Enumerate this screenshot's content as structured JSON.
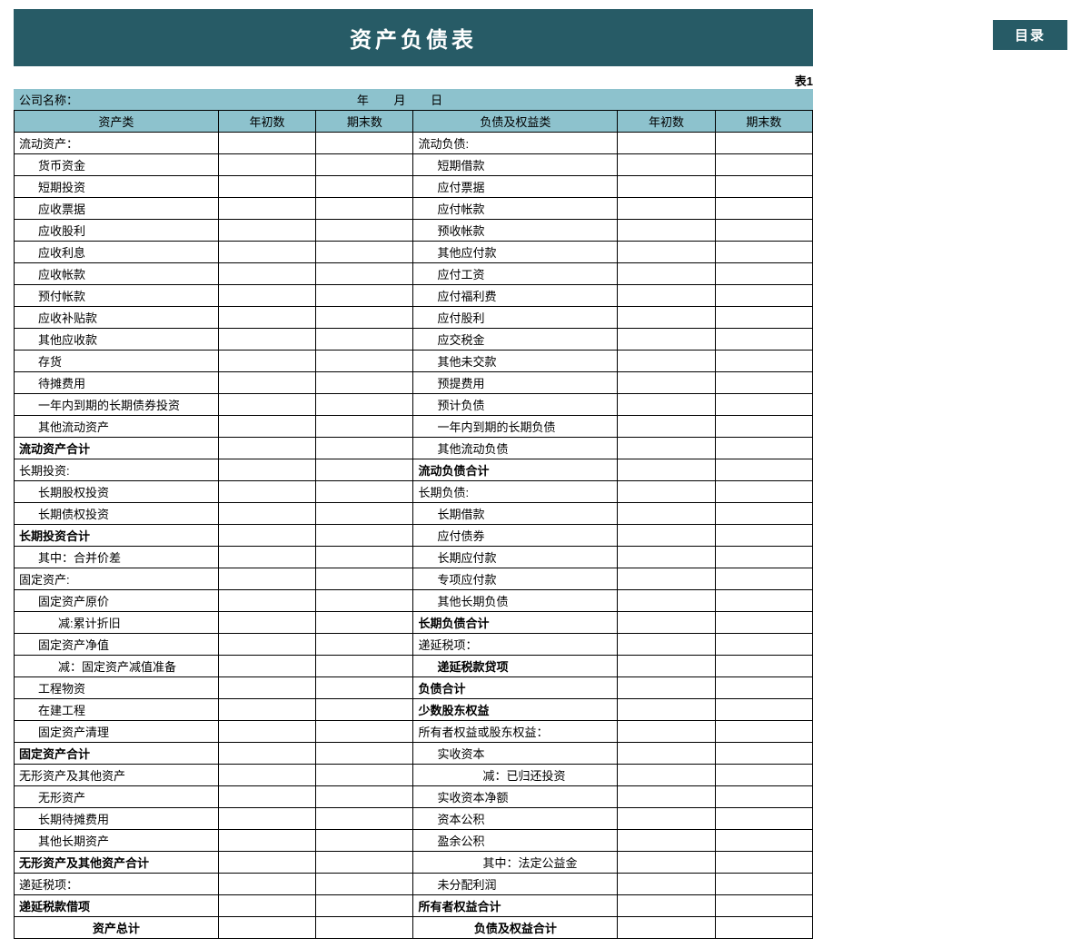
{
  "title": "资产负债表",
  "toc": "目录",
  "tableLabel": "表1",
  "company": "公司名称：",
  "date": "年 月 日",
  "h": {
    "c1": "资产类",
    "c2": "年初数",
    "c3": "期末数",
    "c4": "负债及权益类",
    "c5": "年初数",
    "c6": "期末数"
  },
  "rows": [
    {
      "l": "流动资产：",
      "r": "流动负债:"
    },
    {
      "l": "货币资金",
      "li": 1,
      "r": "短期借款",
      "ri": 1
    },
    {
      "l": "短期投资",
      "li": 1,
      "r": "应付票据",
      "ri": 1
    },
    {
      "l": "应收票据",
      "li": 1,
      "r": "应付帐款",
      "ri": 1
    },
    {
      "l": "应收股利",
      "li": 1,
      "r": "预收帐款",
      "ri": 1
    },
    {
      "l": "应收利息",
      "li": 1,
      "r": "其他应付款",
      "ri": 1
    },
    {
      "l": "应收帐款",
      "li": 1,
      "r": "应付工资",
      "ri": 1
    },
    {
      "l": "预付帐款",
      "li": 1,
      "r": "应付福利费",
      "ri": 1
    },
    {
      "l": "应收补贴款",
      "li": 1,
      "r": "应付股利",
      "ri": 1
    },
    {
      "l": "其他应收款",
      "li": 1,
      "r": "应交税金",
      "ri": 1
    },
    {
      "l": "存货",
      "li": 1,
      "r": "其他未交款",
      "ri": 1
    },
    {
      "l": "待摊费用",
      "li": 1,
      "r": "预提费用",
      "ri": 1
    },
    {
      "l": "一年内到期的长期债券投资",
      "li": 1,
      "r": "预计负债",
      "ri": 1
    },
    {
      "l": "其他流动资产",
      "li": 1,
      "r": "一年内到期的长期负债",
      "ri": 1
    },
    {
      "l": "流动资产合计",
      "lb": 1,
      "r": "其他流动负债",
      "ri": 1
    },
    {
      "l": "长期投资:",
      "r": "流动负债合计",
      "rb": 1
    },
    {
      "l": "长期股权投资",
      "li": 1,
      "r": "长期负债:"
    },
    {
      "l": "长期债权投资",
      "li": 1,
      "r": "长期借款",
      "ri": 1
    },
    {
      "l": "长期投资合计",
      "lb": 1,
      "r": "应付债券",
      "ri": 1
    },
    {
      "l": "其中：合并价差",
      "li": 1,
      "r": "长期应付款",
      "ri": 1
    },
    {
      "l": "固定资产:",
      "r": "专项应付款",
      "ri": 1
    },
    {
      "l": "固定资产原价",
      "li": 1,
      "r": "其他长期负债",
      "ri": 1
    },
    {
      "l": "减:累计折旧",
      "li": 2,
      "r": "长期负债合计",
      "rb": 1
    },
    {
      "l": "固定资产净值",
      "li": 1,
      "r": "递延税项："
    },
    {
      "l": "减：固定资产减值准备",
      "li": 2,
      "r": "递延税款贷项",
      "ri": 1,
      "rb": 1
    },
    {
      "l": "工程物资",
      "li": 1,
      "r": "负债合计",
      "rb": 1
    },
    {
      "l": "在建工程",
      "li": 1,
      "r": "少数股东权益",
      "rb": 1
    },
    {
      "l": "固定资产清理",
      "li": 1,
      "r": "所有者权益或股东权益："
    },
    {
      "l": "固定资产合计",
      "lb": 1,
      "r": "实收资本",
      "ri": 1
    },
    {
      "l": "无形资产及其他资产",
      "r": "减：已归还投资",
      "ri": 3
    },
    {
      "l": "无形资产",
      "li": 1,
      "r": "实收资本净额",
      "ri": 1
    },
    {
      "l": "长期待摊费用",
      "li": 1,
      "r": "资本公积",
      "ri": 1
    },
    {
      "l": "其他长期资产",
      "li": 1,
      "r": "盈余公积",
      "ri": 1
    },
    {
      "l": "无形资产及其他资产合计",
      "lb": 1,
      "r": "其中：法定公益金",
      "ri": 3
    },
    {
      "l": "递延税项：",
      "r": "未分配利润",
      "ri": 1
    },
    {
      "l": "递延税款借项",
      "lb": 1,
      "r": "所有者权益合计",
      "rb": 1
    },
    {
      "l": "资产总计",
      "lb": 1,
      "lc": 1,
      "r": "负债及权益合计",
      "rb": 1,
      "rc": 1
    }
  ]
}
